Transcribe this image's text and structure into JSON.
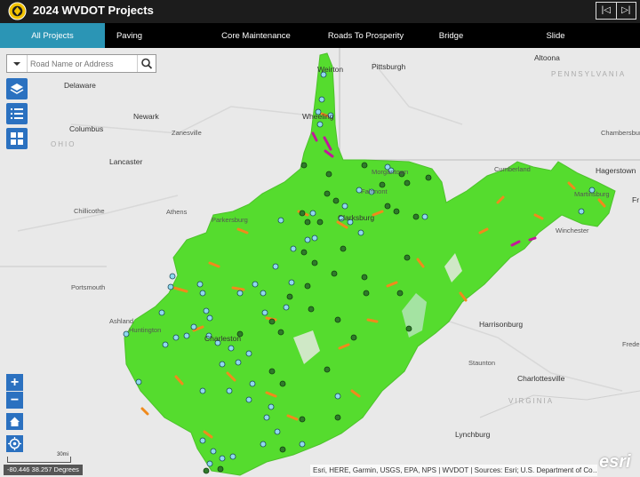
{
  "app": {
    "title": "2024 WVDOT Projects"
  },
  "header_nav": {
    "prev": "|◁",
    "next": "▷|"
  },
  "tabs": [
    {
      "label": "All Projects",
      "active": true
    },
    {
      "label": "Paving"
    },
    {
      "label": "Core Maintenance"
    },
    {
      "label": "Roads To Prosperity"
    },
    {
      "label": "Bridge"
    },
    {
      "label": "Slide"
    }
  ],
  "search": {
    "placeholder": "Road Name or Address"
  },
  "tools": [
    "layers-icon",
    "legend-icon",
    "basemap-gallery-icon"
  ],
  "zoom": {
    "in": "+",
    "out": "−"
  },
  "coordinates": "-80.446 38.257 Degrees",
  "scale_label": "30mi",
  "attribution": "Esri, HERE, Garmin, USGS, EPA, NPS | WVDOT | Sources: Esri; U.S. Department of Co…",
  "esri_logo": "esri",
  "map_labels": {
    "pittsburgh": "Pittsburgh",
    "altoona": "Altoona",
    "pennsylvania": "PENNSYLVANIA",
    "delaware": "Delaware",
    "columbus": "Columbus",
    "newark": "Newark",
    "zanesville": "Zanesville",
    "ohio": "OHIO",
    "lancaster": "Lancaster",
    "chillicothe": "Chillicothe",
    "athens": "Athens",
    "portsmouth": "Portsmouth",
    "ashland": "Ashland",
    "huntington": "Huntington",
    "charleston": "Charleston",
    "parkersburg": "Parkersburg",
    "clarksburg": "Clarksburg",
    "morgantown": "Morgantown",
    "fairmont": "Fairmont",
    "wheeling": "Wheeling",
    "weirton": "Weirton",
    "cumberland": "Cumberland",
    "hagerstown": "Hagerstown",
    "chambersburg": "Chambersburg",
    "martinsburg": "Martinsburg",
    "winchester": "Winchester",
    "harrisonburg": "Harrisonburg",
    "staunton": "Staunton",
    "charlottesville": "Charlottesville",
    "virginia": "VIRGINIA",
    "lynchburg": "Lynchburg",
    "frede": "Frede",
    "fr": "Fr"
  },
  "colors": {
    "header_bg": "#1c1c1c",
    "tab_active": "#2b95b5",
    "tool_blue": "#2b71c0",
    "wv_green": "#55dc2e",
    "project_orange": "#f08a1c",
    "project_magenta": "#c2189a",
    "point_cyan": "#8fd8ef",
    "point_darkgreen": "#2f7a2a"
  }
}
